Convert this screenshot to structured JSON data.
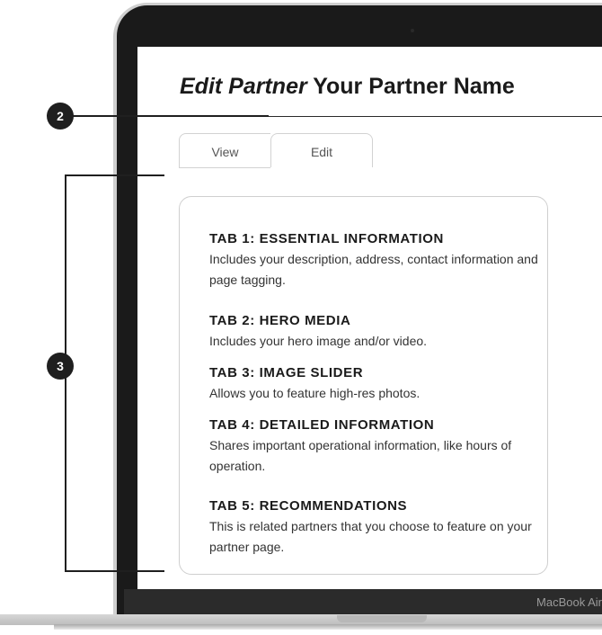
{
  "page": {
    "title_italic": "Edit Partner",
    "title_rest": " Your Partner Name"
  },
  "tabs": [
    {
      "label": "View"
    },
    {
      "label": "Edit"
    }
  ],
  "sections": [
    {
      "heading": "TAB 1: ESSENTIAL INFORMATION",
      "description": "Includes your description, address, contact information and page tagging."
    },
    {
      "heading": "TAB 2: HERO MEDIA",
      "description": "Includes your hero image and/or video."
    },
    {
      "heading": "TAB 3: IMAGE SLIDER",
      "description": "Allows you to feature high-res photos."
    },
    {
      "heading": "TAB 4: DETAILED INFORMATION",
      "description": "Shares important operational information, like hours of operation."
    },
    {
      "heading": "TAB 5: RECOMMENDATIONS",
      "description": "This is related partners that you choose to feature on your partner page."
    }
  ],
  "callouts": [
    {
      "number": "2"
    },
    {
      "number": "3"
    }
  ],
  "device": {
    "brand_label": "MacBook Air"
  },
  "colors": {
    "bezel": "#1a1a1a",
    "callout": "#1f1f1f",
    "card_border": "#cfcfcf"
  }
}
